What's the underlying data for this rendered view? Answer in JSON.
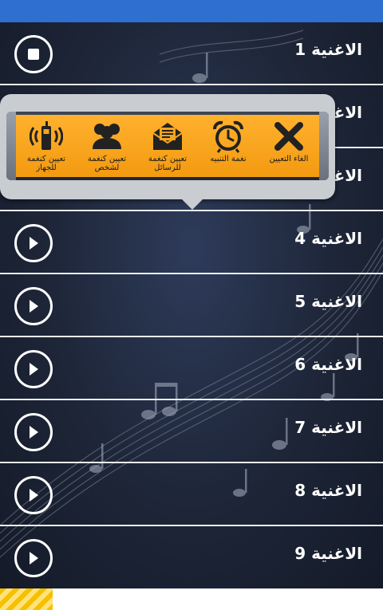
{
  "song_list": [
    {
      "label": "الاغنية 1",
      "state": "playing",
      "icon": "stop-icon"
    },
    {
      "label": "الاغنية 2",
      "state": "paused",
      "icon": "play-icon"
    },
    {
      "label": "الاغنية 3",
      "state": "paused",
      "icon": "play-icon"
    },
    {
      "label": "الاغنية 4",
      "state": "paused",
      "icon": "play-icon"
    },
    {
      "label": "الاغنية 5",
      "state": "paused",
      "icon": "play-icon"
    },
    {
      "label": "الاغنية 6",
      "state": "paused",
      "icon": "play-icon"
    },
    {
      "label": "الاغنية 7",
      "state": "paused",
      "icon": "play-icon"
    },
    {
      "label": "الاغنية 8",
      "state": "paused",
      "icon": "play-icon"
    },
    {
      "label": "الاغنية 9",
      "state": "paused",
      "icon": "play-icon"
    }
  ],
  "popup_menu": {
    "actions": [
      {
        "label": "الغاء التعيين",
        "icon": "close-icon"
      },
      {
        "label": "نغمة التنبيه",
        "icon": "alarm-clock-icon"
      },
      {
        "label": "تعيين كنغمة للرسائل",
        "icon": "envelope-icon"
      },
      {
        "label": "تعيين كنغمة لشخص",
        "icon": "contact-icon"
      },
      {
        "label": "تعيين كنغمة للجهاز",
        "icon": "ringing-phone-icon"
      }
    ]
  },
  "colors": {
    "status_bar": "#2f6fd0",
    "toolbar_orange": "#f39a10",
    "row_divider": "#e9edf3",
    "footer_stripe": "#f4c000"
  }
}
